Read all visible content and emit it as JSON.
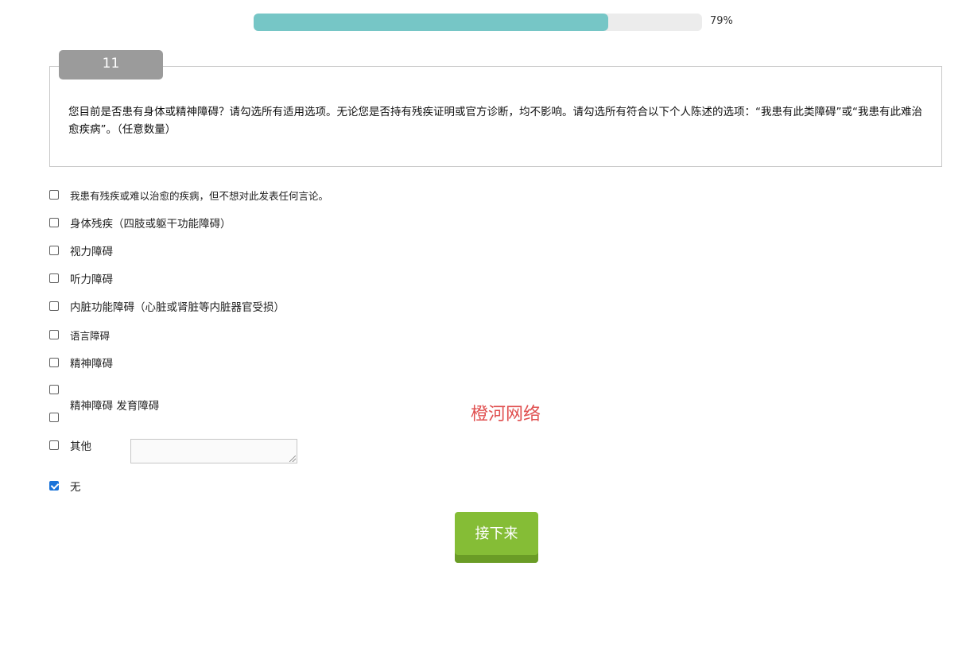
{
  "progress": {
    "value": 79,
    "label": "79%"
  },
  "question": {
    "number": "11",
    "text": "您目前是否患有身体或精神障碍？请勾选所有适用选项。无论您是否持有残疾证明或官方诊断，均不影响。请勾选所有符合以下个人陈述的选项：“我患有此类障碍”或“我患有此难治愈疾病”。（任意数量）"
  },
  "options": [
    {
      "label": "我患有残疾或难以治愈的疾病，但不想对此发表任何言论。",
      "checked": false
    },
    {
      "label": "身体残疾（四肢或躯干功能障碍）",
      "checked": false
    },
    {
      "label": "视力障碍",
      "checked": false
    },
    {
      "label": "听力障碍",
      "checked": false
    },
    {
      "label": "内脏功能障碍（心脏或肾脏等内脏器官受损）",
      "checked": false
    },
    {
      "label": "语言障碍",
      "checked": false
    },
    {
      "label": "精神障碍",
      "checked": false
    },
    {
      "label": "",
      "checked": false
    },
    {
      "label": "精神障碍 发育障碍",
      "checked": false
    },
    {
      "label": "其他",
      "checked": false
    },
    {
      "label": "无",
      "checked": true
    }
  ],
  "other_input": {
    "value": ""
  },
  "watermark": "橙河网络",
  "next_button": {
    "label": "接下来"
  },
  "colors": {
    "progress_fill": "#76c6c6",
    "progress_track": "#ececec",
    "question_number_bg": "#9b9b9b",
    "checkbox_checked": "#1a73d9",
    "next_button": "#85bd36",
    "watermark": "#e05050"
  }
}
